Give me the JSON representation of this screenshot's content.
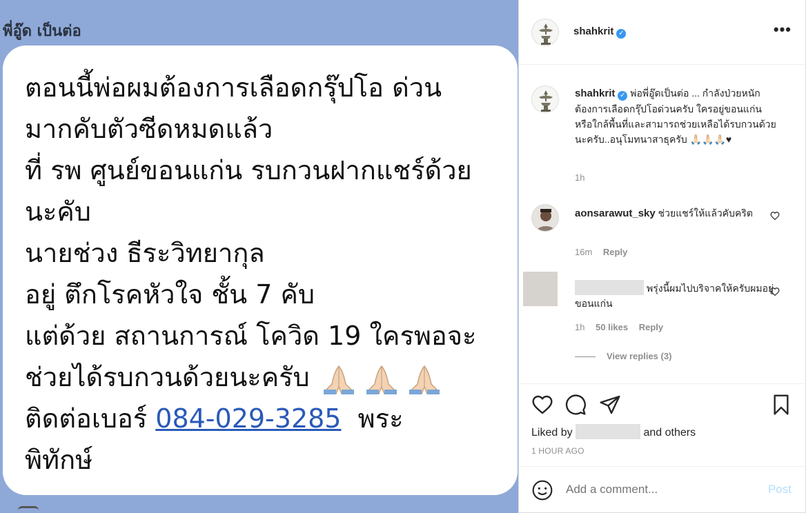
{
  "image": {
    "sender": "พี่อู๊ด เป็นต่อ",
    "lines": [
      "ตอนนี้พ่อผมต้องการเลือดกรุ๊ปโอ ด่วน",
      "มากคับตัวซีดหมดแล้ว",
      "ที่ รพ ศูนย์ขอนแก่น รบกวนฝากแชร์ด้วย",
      "นะคับ",
      "นายช่วง ธีระวิทยากุล",
      "อยู่ ตึกโรคหัวใจ ชั้น 7 คับ",
      "แต่ด้วย สถานการณ์ โควิด 19 ใครพอจะ",
      "ช่วยได้รบกวนด้วยนะครับ"
    ],
    "contact_prefix": "ติดต่อเบอร์ ",
    "phone": "084-029-3285",
    "contact_suffix": "  พระ",
    "last_line": "พิทักษ์"
  },
  "post": {
    "username": "shahkrit",
    "more_label": "•••",
    "caption": "พ่อพี่อู๊ดเป็นต่อ ... กำลังป่วยหนักต้องการเลือดกรุ๊ปโอด่วนครับ ใครอยู่ขอนแก่น หรือใกล้พื้นที่และสามารถช่วยเหลือได้รบกวนด้วยนะครับ..อนุโมทนาสาธุครับ 🙏🏻🙏🏻🙏🏻♥",
    "caption_time": "1h"
  },
  "comments": [
    {
      "username": "aonsarawut_sky",
      "text": "ช่วยแชร์ให้แล้วคับคริต",
      "time": "16m",
      "reply_label": "Reply"
    },
    {
      "text": "พรุ่งนี้ผมไปบริจาคให้ครับผมอยู่ขอนแก่น",
      "time": "1h",
      "likes": "50 likes",
      "reply_label": "Reply",
      "view_replies": "View replies (3)"
    }
  ],
  "actions": {
    "liked_by_prefix": "Liked by",
    "liked_by_suffix": "and others",
    "time_ago": "1 HOUR AGO"
  },
  "comment_bar": {
    "placeholder": "Add a comment...",
    "post_label": "Post"
  },
  "icons": {
    "heart": "heart-icon",
    "comment": "comment-icon",
    "share": "share-icon",
    "save": "bookmark-icon",
    "emoji": "emoji-icon"
  },
  "colors": {
    "photo_bg": "#8ea9d8",
    "link": "#2a5ab8",
    "verified": "#3897f0",
    "post_disabled": "#b2dffc"
  }
}
